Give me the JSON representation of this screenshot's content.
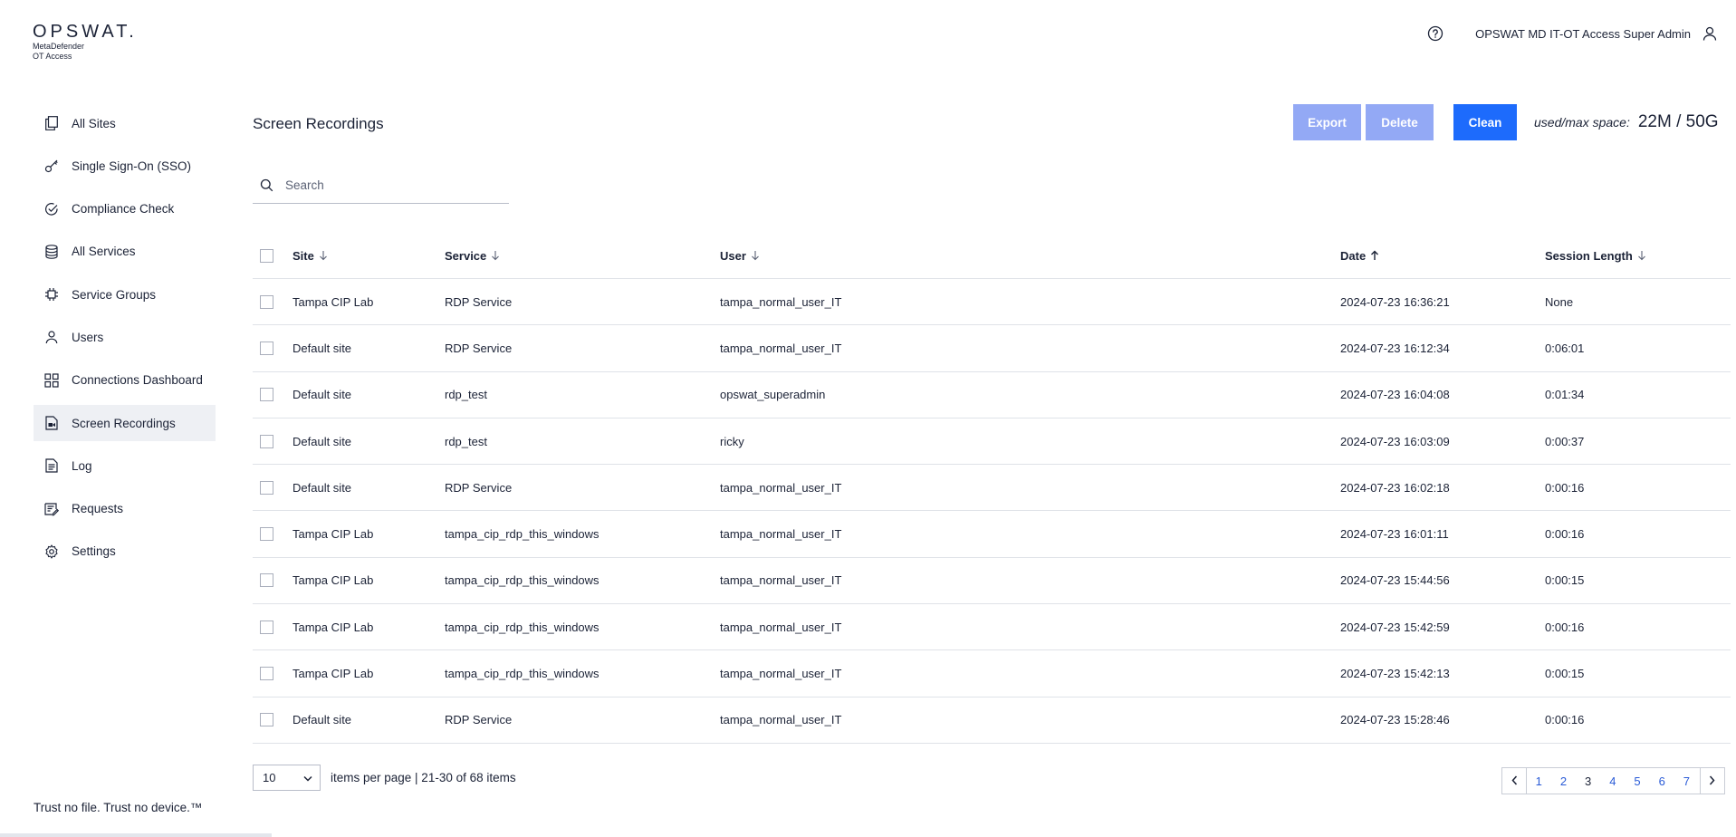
{
  "header": {
    "brand": "OPSWAT.",
    "sub_line1": "MetaDefender",
    "sub_line2": "OT Access",
    "user_name": "OPSWAT MD IT-OT Access Super Admin"
  },
  "sidebar": {
    "items": [
      {
        "label": "All Sites",
        "icon": "pages-icon"
      },
      {
        "label": "Single Sign-On (SSO)",
        "icon": "key-icon"
      },
      {
        "label": "Compliance Check",
        "icon": "check-circle-icon"
      },
      {
        "label": "All Services",
        "icon": "database-icon"
      },
      {
        "label": "Service Groups",
        "icon": "stack-icon"
      },
      {
        "label": "Users",
        "icon": "user-icon"
      },
      {
        "label": "Connections Dashboard",
        "icon": "grid-icon"
      },
      {
        "label": "Screen Recordings",
        "icon": "recording-icon",
        "active": true
      },
      {
        "label": "Log",
        "icon": "document-icon"
      },
      {
        "label": "Requests",
        "icon": "request-icon"
      },
      {
        "label": "Settings",
        "icon": "gear-icon"
      }
    ],
    "footer": "Trust no file. Trust no device.™"
  },
  "main": {
    "title": "Screen Recordings",
    "toolbar": {
      "export_label": "Export",
      "delete_label": "Delete",
      "clean_label": "Clean",
      "space_label": "used/max space:",
      "space_value": "22M / 50G"
    },
    "search": {
      "placeholder": "Search",
      "value": ""
    },
    "table": {
      "columns": [
        "Site",
        "Service",
        "User",
        "Date",
        "Session Length"
      ],
      "rows": [
        [
          "Tampa CIP Lab",
          "RDP Service",
          "tampa_normal_user_IT",
          "2024-07-23 16:36:21",
          "None"
        ],
        [
          "Default site",
          "RDP Service",
          "tampa_normal_user_IT",
          "2024-07-23 16:12:34",
          "0:06:01"
        ],
        [
          "Default site",
          "rdp_test",
          "opswat_superadmin",
          "2024-07-23 16:04:08",
          "0:01:34"
        ],
        [
          "Default site",
          "rdp_test",
          "ricky",
          "2024-07-23 16:03:09",
          "0:00:37"
        ],
        [
          "Default site",
          "RDP Service",
          "tampa_normal_user_IT",
          "2024-07-23 16:02:18",
          "0:00:16"
        ],
        [
          "Tampa CIP Lab",
          "tampa_cip_rdp_this_windows",
          "tampa_normal_user_IT",
          "2024-07-23 16:01:11",
          "0:00:16"
        ],
        [
          "Tampa CIP Lab",
          "tampa_cip_rdp_this_windows",
          "tampa_normal_user_IT",
          "2024-07-23 15:44:56",
          "0:00:15"
        ],
        [
          "Tampa CIP Lab",
          "tampa_cip_rdp_this_windows",
          "tampa_normal_user_IT",
          "2024-07-23 15:42:59",
          "0:00:16"
        ],
        [
          "Tampa CIP Lab",
          "tampa_cip_rdp_this_windows",
          "tampa_normal_user_IT",
          "2024-07-23 15:42:13",
          "0:00:15"
        ],
        [
          "Default site",
          "RDP Service",
          "tampa_normal_user_IT",
          "2024-07-23 15:28:46",
          "0:00:16"
        ]
      ]
    },
    "pagination": {
      "per_page": "10",
      "summary": "items per page | 21-30 of 68 items",
      "pages": [
        "1",
        "2",
        "3",
        "4",
        "5",
        "6",
        "7"
      ],
      "current_page": "3"
    }
  },
  "colors": {
    "primary": "#1d6bfc",
    "disabled_button": "#93a9f5",
    "active_nav_bg": "#eef0f4",
    "text": "#1b2236"
  }
}
